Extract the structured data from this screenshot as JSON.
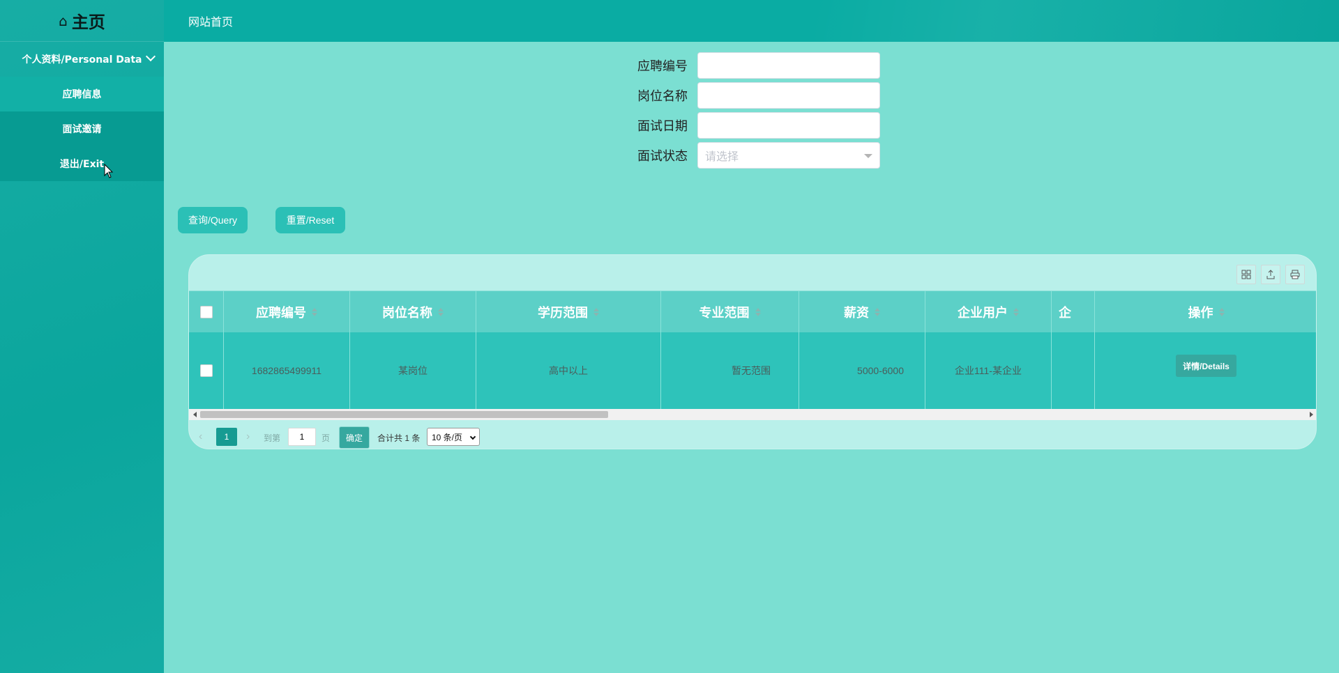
{
  "sidebar": {
    "brand": "主页",
    "brand_icon": "⌂",
    "group_label": "个人资料/Personal Data",
    "items": [
      {
        "label": "应聘信息"
      },
      {
        "label": "面试邀请"
      },
      {
        "label": "退出/Exit"
      }
    ]
  },
  "topbar": {
    "title": "网站首页"
  },
  "search": {
    "fields": [
      {
        "label": "应聘编号",
        "value": ""
      },
      {
        "label": "岗位名称",
        "value": ""
      },
      {
        "label": "面试日期",
        "value": ""
      },
      {
        "label": "面试状态",
        "placeholder": "请选择"
      }
    ],
    "query_label": "查询/Query",
    "reset_label": "重置/Reset"
  },
  "table": {
    "columns": [
      "应聘编号",
      "岗位名称",
      "学历范围",
      "专业范围",
      "薪资",
      "企业用户",
      "企",
      "操作"
    ],
    "rows": [
      {
        "id": "1682865499911",
        "position": "某岗位",
        "education": "高中以上",
        "major": "暂无范围",
        "salary": "5000-6000",
        "company": "企业111-某企业",
        "partial": "",
        "action": "详情/Details"
      }
    ]
  },
  "pagination": {
    "current_page": "1",
    "goto_label": "到第",
    "goto_value": "1",
    "page_suffix": "页",
    "confirm_label": "确定",
    "total_text": "合计共 1 条",
    "page_size": "10 条/页"
  },
  "colors": {
    "background": "#7bdfd2",
    "sidebar": "#0ba9a0",
    "topbar": "#0aaca3",
    "table_header": "#5cd0c7",
    "table_row": "#2ec3ba",
    "button": "#2bc0b6"
  }
}
